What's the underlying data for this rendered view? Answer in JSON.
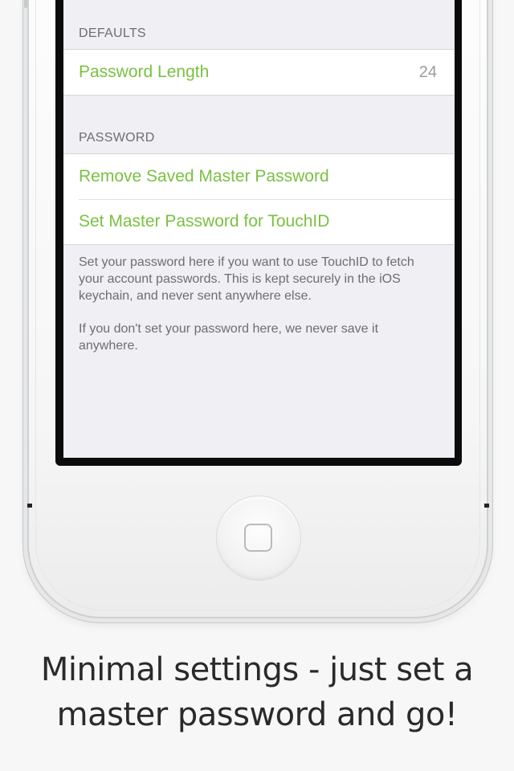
{
  "settings": {
    "defaults_header": "DEFAULTS",
    "password_length": {
      "label": "Password Length",
      "value": "24"
    },
    "password_header": "PASSWORD",
    "password_items": [
      {
        "label": "Remove Saved Master Password"
      },
      {
        "label": "Set Master Password for TouchID"
      }
    ],
    "footer_paragraph_1": "Set your password here if you want to use TouchID to fetch your account passwords. This is kept securely in the iOS keychain, and never sent anywhere else.",
    "footer_paragraph_2": "If you don't set your password here, we never save it anywhere."
  },
  "caption": {
    "line1": "Minimal settings - just set a",
    "line2": "master password and go!"
  },
  "colors": {
    "accent": "#7ac142",
    "background": "#efeff4",
    "section_text": "#6d6d72",
    "caption_text": "#2a2a2a"
  },
  "icons": {
    "home_button": "home-button-icon"
  }
}
